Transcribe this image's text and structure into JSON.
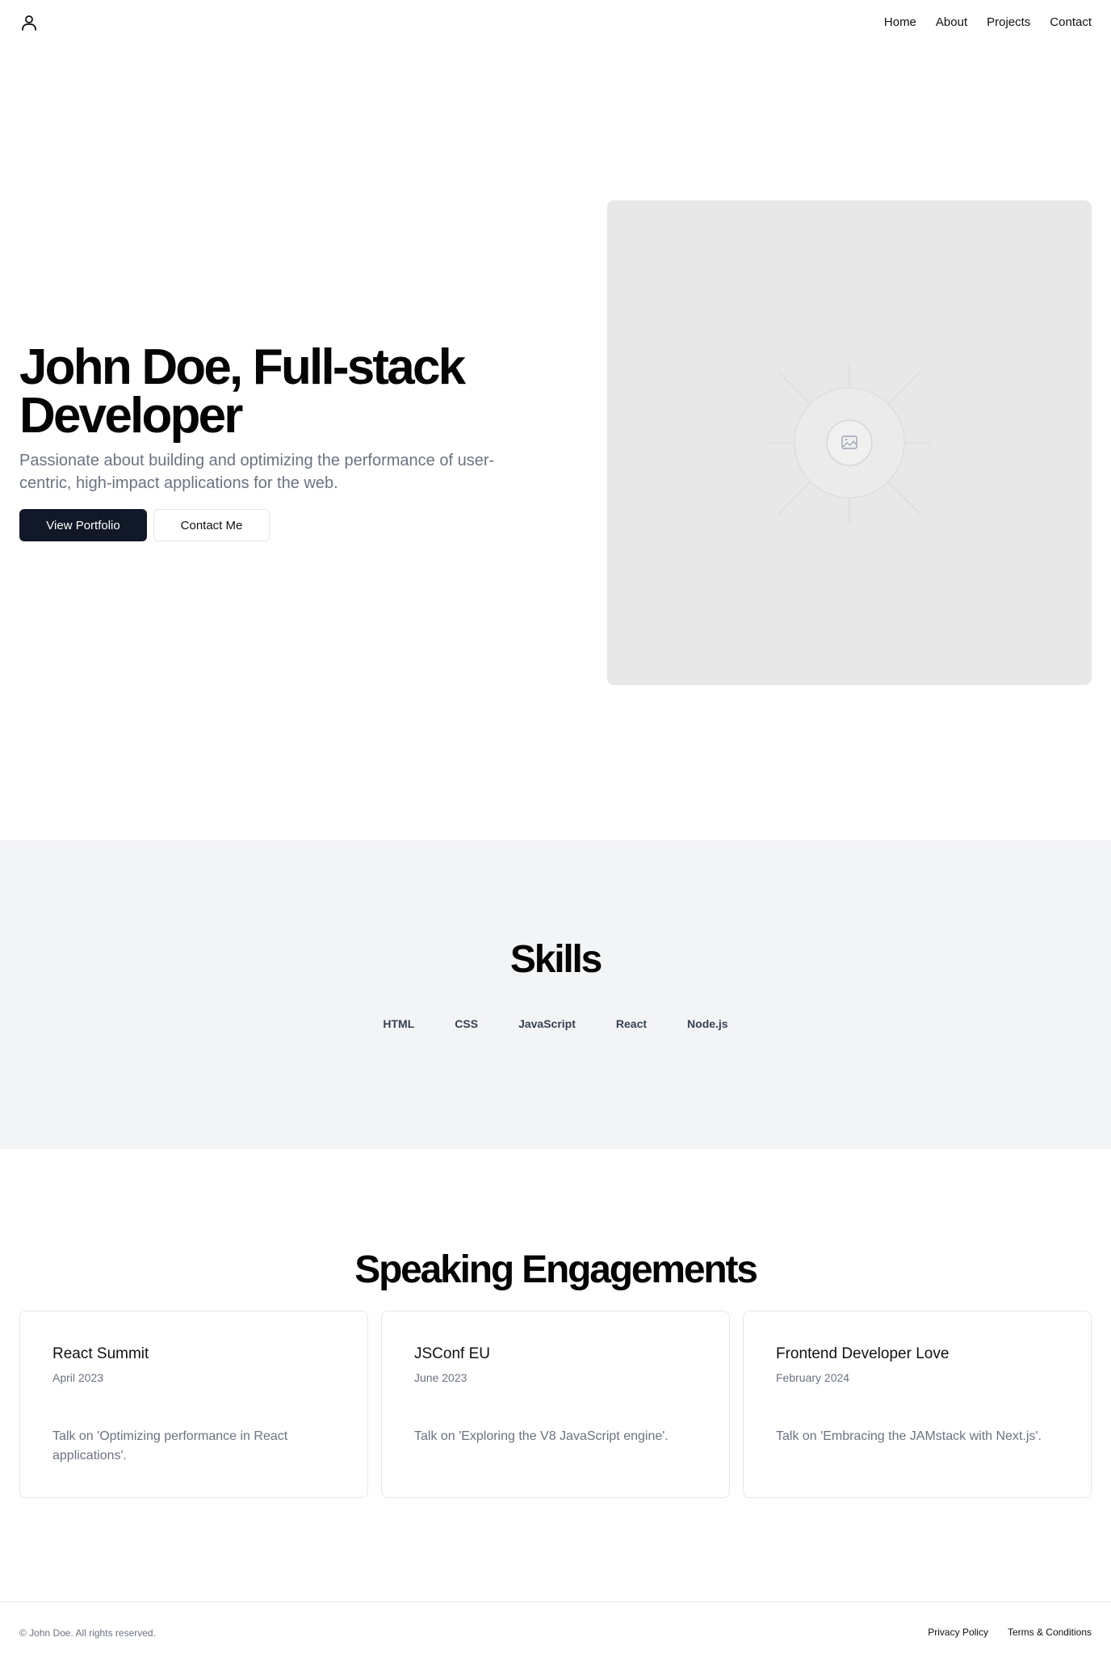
{
  "header": {
    "logo_icon": "user-icon",
    "nav": [
      "Home",
      "About",
      "Projects",
      "Contact"
    ]
  },
  "hero": {
    "title": "John Doe, Full-stack Developer",
    "subtitle": "Passionate about building and optimizing the performance of user-centric, high-impact applications for the web.",
    "primary_button": "View Portfolio",
    "secondary_button": "Contact Me",
    "image_icon": "image-placeholder-icon"
  },
  "skills": {
    "title": "Skills",
    "items": [
      "HTML",
      "CSS",
      "JavaScript",
      "React",
      "Node.js"
    ]
  },
  "speaking": {
    "title": "Speaking Engagements",
    "cards": [
      {
        "title": "React Summit",
        "date": "April 2023",
        "description": "Talk on 'Optimizing performance in React applications'."
      },
      {
        "title": "JSConf EU",
        "date": "June 2023",
        "description": "Talk on 'Exploring the V8 JavaScript engine'."
      },
      {
        "title": "Frontend Developer Love",
        "date": "February 2024",
        "description": "Talk on 'Embracing the JAMstack with Next.js'."
      }
    ]
  },
  "footer": {
    "copyright": "© John Doe. All rights reserved.",
    "links": [
      "Privacy Policy",
      "Terms & Conditions"
    ]
  },
  "colors": {
    "primary_button_bg": "#111827",
    "skills_bg": "#f3f4f6",
    "image_placeholder_bg": "#e8e8e8",
    "muted_text": "#6b7280"
  }
}
